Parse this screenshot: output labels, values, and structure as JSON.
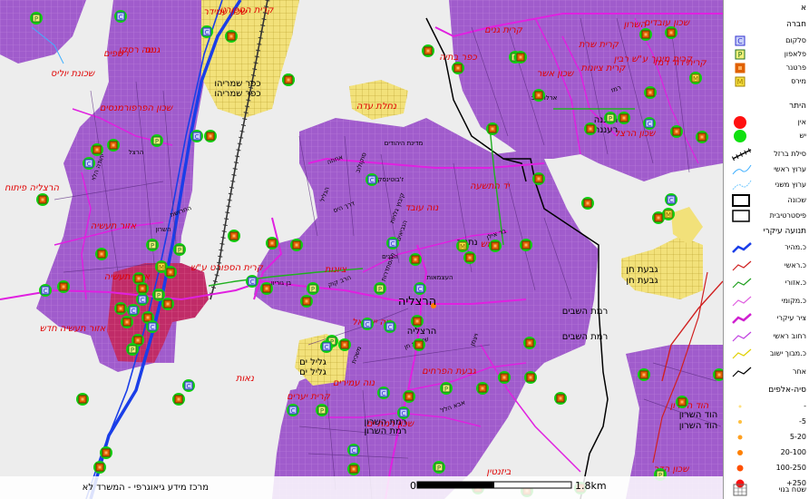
{
  "colors": {
    "land": "#ededed",
    "urban": "#a05ccc",
    "urban_grid": "#c488e0",
    "industrial": "#c02c68",
    "settlement": "#f2e17a",
    "road_main": "#e020e0",
    "road_highway": "#1a3ee8",
    "road_green": "#20b020",
    "rail": "#333333",
    "label_red": "#e00000",
    "boundary": "#000000"
  },
  "map": {
    "city_label": "הרצליה",
    "neighborhoods": [
      {
        "text": "קרית הספורט"
      },
      {
        "text": "שכון עובדים"
      },
      {
        "text": "קרית גנים"
      },
      {
        "text": "קרית שרת"
      },
      {
        "text": "קרית מינוך ע\"ש רבין"
      },
      {
        "text": "כפר בתיה"
      },
      {
        "text": "קרית ציונות"
      },
      {
        "text": "קרית דוד רמז"
      },
      {
        "text": "שכון אשר"
      },
      {
        "text": "שכונת יוליס"
      },
      {
        "text": "נוה רסקו"
      },
      {
        "text": "שכון עמידר"
      },
      {
        "text": "שכון הפרפורמנסים"
      },
      {
        "text": "נחלת עדה"
      },
      {
        "text": "הרצליה פיתוח"
      },
      {
        "text": "אזור תעשיה"
      },
      {
        "text": "קרית הספורט ע\"ש"
      },
      {
        "text": "אזור תעשיה"
      },
      {
        "text": "אזור תעשיה חדש"
      },
      {
        "text": "יד התשעה"
      },
      {
        "text": "נוה עובד"
      },
      {
        "text": "נוה ישראל"
      },
      {
        "text": "גבעת הפרחים"
      },
      {
        "text": "נוה עמירים"
      },
      {
        "text": "קרית יערים"
      },
      {
        "text": "שכון הדר"
      },
      {
        "text": "ציונות"
      },
      {
        "text": "חמש"
      },
      {
        "text": "שכון הרצל"
      },
      {
        "text": "ביזנטין"
      },
      {
        "text": "שכון רמת ים"
      },
      {
        "text": "הוד השרון"
      },
      {
        "text": "נאות"
      },
      {
        "text": "גנים"
      },
      {
        "text": "רשפים"
      },
      {
        "text": "השרון"
      }
    ],
    "places": [
      {
        "text": "כפר שמריהו"
      },
      {
        "text": "כפר שמריהו"
      },
      {
        "text": "גליל ים"
      },
      {
        "text": "גליל ים"
      },
      {
        "text": "גבעת חן"
      },
      {
        "text": "גבעת חן"
      },
      {
        "text": "רעננה"
      },
      {
        "text": "רעננה"
      },
      {
        "text": "הוד השרון"
      },
      {
        "text": "הוד השרון"
      },
      {
        "text": "רמת השבים"
      },
      {
        "text": "רמת השבים"
      },
      {
        "text": "רמת השרון"
      },
      {
        "text": "רמת השרון"
      },
      {
        "text": "הרצליה"
      },
      {
        "text": "נתניה"
      }
    ],
    "streets": [
      {
        "text": "סוקולוב"
      },
      {
        "text": "בן גוריון"
      },
      {
        "text": "הרב קוק"
      },
      {
        "text": "ויצמן"
      },
      {
        "text": "ז'בוטינסקי"
      },
      {
        "text": "שדרות חן"
      },
      {
        "text": "הנביאים"
      },
      {
        "text": "הבנים"
      },
      {
        "text": "אחוזה"
      },
      {
        "text": "ההסתדרות"
      },
      {
        "text": "העצמאות"
      },
      {
        "text": "בר אילן"
      },
      {
        "text": "יהודה הלוי"
      },
      {
        "text": "הרצל"
      },
      {
        "text": "החרושת"
      },
      {
        "text": "משכית"
      },
      {
        "text": "מדינת היהודים"
      },
      {
        "text": "אבא הלל"
      },
      {
        "text": "הגליל"
      },
      {
        "text": "ארלוזורוב"
      },
      {
        "text": "רמז"
      },
      {
        "text": "קיבוץ גלויות"
      },
      {
        "text": "השרון"
      },
      {
        "text": "דרך הים"
      }
    ],
    "scale_zero": "0",
    "scale_label": "1.8km",
    "credit": "מרכז מידע גיאוגרפי - המשרד לא"
  },
  "legend": {
    "title": "א",
    "sections": [
      {
        "title": "חברה",
        "items": [
          {
            "label": "סלקום",
            "icon": "cellcom-icon",
            "glyph": "C",
            "color": "#3030d0"
          },
          {
            "label": "פלאפון",
            "icon": "pelephone-icon",
            "glyph": "P",
            "color": "#207020"
          },
          {
            "label": "פרטנר",
            "icon": "partner-icon",
            "glyph": "",
            "color": "#e06000"
          },
          {
            "label": "מירס",
            "icon": "mirs-icon",
            "glyph": "M",
            "color": "#a08000"
          }
        ]
      },
      {
        "title": "היתר",
        "items": [
          {
            "label": "אין",
            "icon": "no-permit-icon",
            "color": "#ff1010"
          },
          {
            "label": "יש",
            "icon": "permit-icon",
            "color": "#10e010"
          }
        ]
      },
      {
        "title": "",
        "items": [
          {
            "label": "סילת ברזל",
            "icon": "railway-line-icon",
            "color": "#000000"
          },
          {
            "label": "ערוץ ראשי",
            "icon": "main-channel-icon",
            "color": "#40b0ff"
          },
          {
            "label": "ערוץ משני",
            "icon": "secondary-channel-icon",
            "color": "#70c8ff"
          },
          {
            "label": "שכונה",
            "icon": "neighborhood-icon",
            "color": "#000000"
          },
          {
            "label": "פיסטרטיבית",
            "icon": "admin-boundary-icon",
            "color": "#000000"
          }
        ]
      },
      {
        "title": "תנועה עיקרי",
        "items": [
          {
            "label": "כ.מהיר",
            "icon": "expressway-icon",
            "color": "#1a3ee8"
          },
          {
            "label": "כ.ראשי",
            "icon": "main-road-icon",
            "color": "#d02020"
          },
          {
            "label": "כ.אזורי",
            "icon": "regional-road-icon",
            "color": "#20a020"
          },
          {
            "label": "כ.מקומי",
            "icon": "local-road-icon",
            "color": "#e060e0"
          },
          {
            "label": "ציר עיקרי",
            "icon": "main-axis-icon",
            "color": "#d020d0"
          },
          {
            "label": "רחוב ראשי",
            "icon": "main-street-icon",
            "color": "#c040e0"
          },
          {
            "label": "כ.מבוך ישוב",
            "icon": "settlement-road-icon",
            "color": "#e0d000"
          },
          {
            "label": "אחר",
            "icon": "other-road-icon",
            "color": "#000000"
          }
        ]
      },
      {
        "title": "סיה-אלפים",
        "items": [
          {
            "label": "-",
            "icon": "pop-0-icon",
            "color": "#ffe080",
            "size": 1.5
          },
          {
            "label": "5-",
            "icon": "pop-1-icon",
            "color": "#ffc040",
            "size": 2
          },
          {
            "label": "5-20",
            "icon": "pop-2-icon",
            "color": "#ffa020",
            "size": 2.5
          },
          {
            "label": "20-100",
            "icon": "pop-3-icon",
            "color": "#ff8000",
            "size": 3
          },
          {
            "label": "100-250",
            "icon": "pop-4-icon",
            "color": "#ff5000",
            "size": 3.5
          },
          {
            "label": "250+",
            "icon": "pop-5-icon",
            "color": "#ff1010",
            "size": 4.5
          }
        ]
      },
      {
        "title": "",
        "items": [
          {
            "label": "שטח בנוי",
            "icon": "built-area-icon",
            "color": "#888888"
          }
        ]
      }
    ]
  }
}
